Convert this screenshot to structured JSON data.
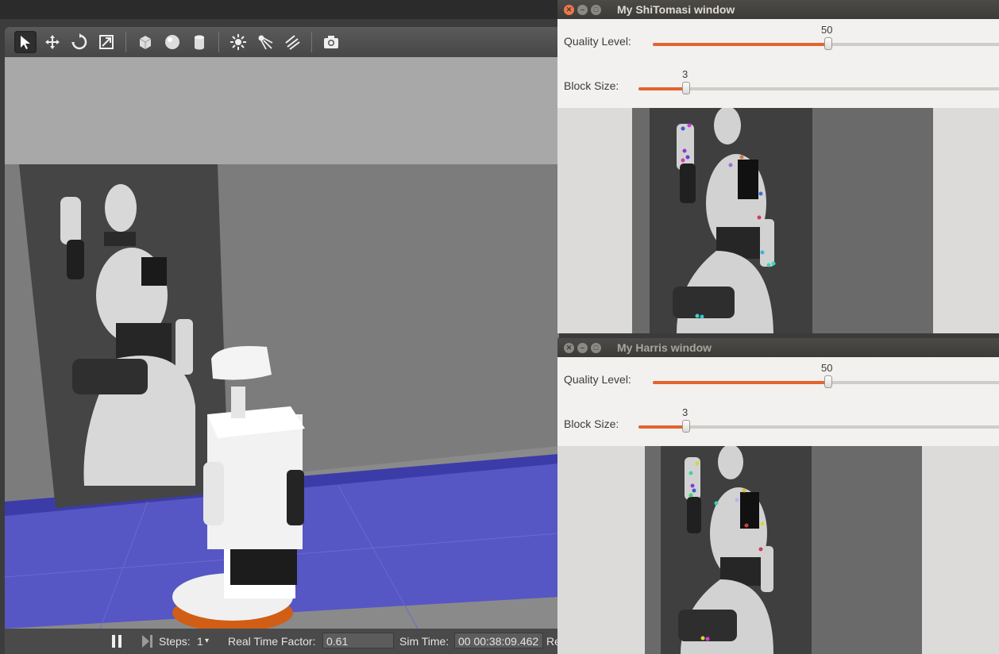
{
  "gazebo": {
    "status": {
      "steps_label": "Steps:",
      "steps_value": "1",
      "rtf_label": "Real Time Factor:",
      "rtf_value": "0.61",
      "simtime_label": "Sim Time:",
      "simtime_value": "00 00:38:09.462",
      "overflow_label": "Re"
    },
    "toolbar_icons": [
      "select-arrow-icon",
      "translate-icon",
      "rotate-icon",
      "scale-icon",
      "box-icon",
      "sphere-icon",
      "cylinder-icon",
      "point-light-icon",
      "spot-light-icon",
      "directional-light-icon",
      "screenshot-icon"
    ]
  },
  "shitomasi_window": {
    "title": "My ShiTomasi window",
    "quality": {
      "label": "Quality Level:",
      "value": "50",
      "fraction": 0.5
    },
    "block": {
      "label": "Block Size:",
      "value": "3",
      "fraction": 0.13
    }
  },
  "harris_window": {
    "title": "My Harris window",
    "quality": {
      "label": "Quality Level:",
      "value": "50",
      "fraction": 0.5
    },
    "block": {
      "label": "Block Size:",
      "value": "3",
      "fraction": 0.13
    }
  },
  "colors": {
    "accent": "#e3642e",
    "floor": "#5656c4",
    "titlebar": "#3c3b37"
  }
}
